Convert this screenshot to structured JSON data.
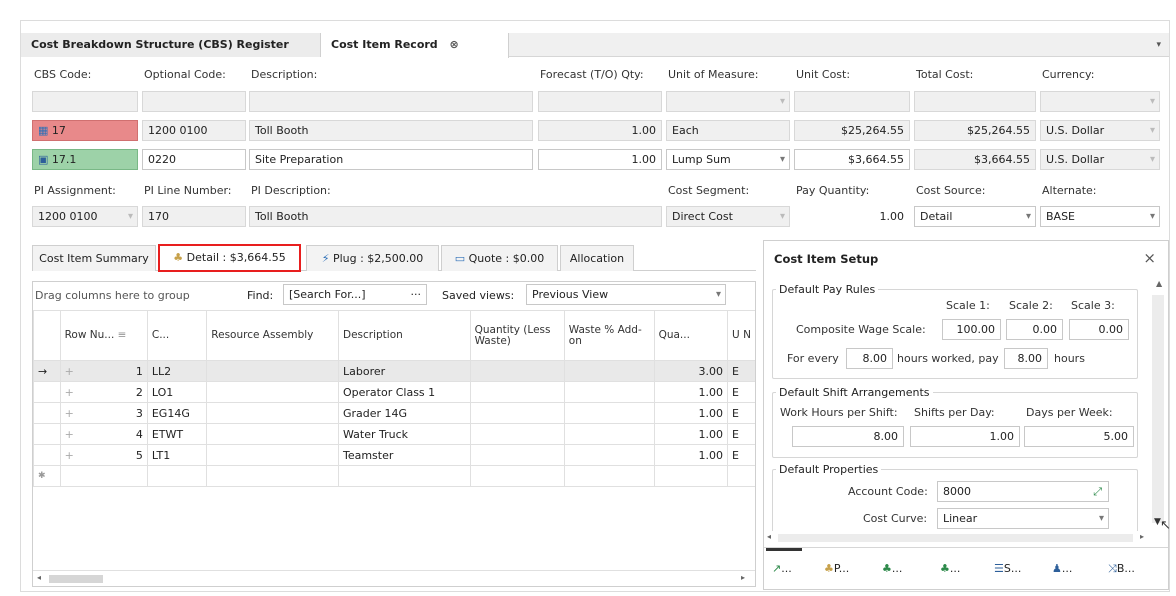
{
  "tabs": {
    "cbs_register": "Cost Breakdown Structure (CBS) Register",
    "cost_item_record": "Cost Item Record"
  },
  "header": {
    "labels": {
      "cbs_code": "CBS Code:",
      "optional_code": "Optional Code:",
      "description": "Description:",
      "forecast": "Forecast (T/O) Qty:",
      "uom": "Unit of Measure:",
      "unit_cost": "Unit Cost:",
      "total_cost": "Total Cost:",
      "currency": "Currency:"
    },
    "row1": {
      "cbs_code": "17",
      "optional_code": "1200 0100",
      "description": "Toll Booth",
      "forecast": "1.00",
      "uom": "Each",
      "unit_cost": "$25,264.55",
      "total_cost": "$25,264.55",
      "currency": "U.S. Dollar"
    },
    "row2": {
      "cbs_code": "17.1",
      "optional_code": "0220",
      "description": "Site Preparation",
      "forecast": "1.00",
      "uom": "Lump Sum",
      "unit_cost": "$3,664.55",
      "total_cost": "$3,664.55",
      "currency": "U.S. Dollar"
    },
    "labels2": {
      "pi_assignment": "PI Assignment:",
      "pi_line": "PI Line Number:",
      "pi_desc": "PI Description:",
      "cost_segment": "Cost Segment:",
      "pay_qty": "Pay Quantity:",
      "cost_source": "Cost Source:",
      "alternate": "Alternate:"
    },
    "row3": {
      "pi_assignment": "1200 0100",
      "pi_line": "170",
      "pi_desc": "Toll Booth",
      "cost_segment": "Direct Cost",
      "pay_qty": "1.00",
      "cost_source": "Detail",
      "alternate": "BASE"
    },
    "colors": {
      "row1_code": "#e8898a",
      "row2_code": "#9dd2a8",
      "highlight": "#e81e1e"
    }
  },
  "subtabs": {
    "summary": "Cost Item Summary",
    "detail": "Detail : $3,664.55",
    "plug": "Plug : $2,500.00",
    "quote": "Quote : $0.00",
    "allocation": "Allocation"
  },
  "grid": {
    "group_hint": "Drag columns here to group",
    "find_label": "Find:",
    "find_placeholder": "[Search For...]",
    "find_btn": "···",
    "saved_views_label": "Saved views:",
    "saved_view": "Previous View",
    "columns": [
      "Row Nu...",
      "C...",
      "Resource Assembly",
      "Description",
      "Quantity (Less Waste)",
      "Waste % Add-on",
      "Qua...",
      "U N"
    ],
    "rows": [
      {
        "num": "1",
        "code": "LL2",
        "desc": "Laborer",
        "qty": "3.00",
        "u": "E"
      },
      {
        "num": "2",
        "code": "LO1",
        "desc": "Operator Class 1",
        "qty": "1.00",
        "u": "E"
      },
      {
        "num": "3",
        "code": "EG14G",
        "desc": "Grader 14G",
        "qty": "1.00",
        "u": "E"
      },
      {
        "num": "4",
        "code": "ETWT",
        "desc": "Water Truck",
        "qty": "1.00",
        "u": "E"
      },
      {
        "num": "5",
        "code": "LT1",
        "desc": "Teamster",
        "qty": "1.00",
        "u": "E"
      }
    ]
  },
  "setup": {
    "title": "Cost Item Setup",
    "pay_rules": {
      "title": "Default Pay Rules",
      "scale1": "Scale 1:",
      "scale2": "Scale 2:",
      "scale3": "Scale 3:",
      "composite": "Composite Wage Scale:",
      "v1": "100.00",
      "v2": "0.00",
      "v3": "0.00",
      "for_every": "For every",
      "hours_val": "8.00",
      "hours_worked": "hours worked, pay",
      "pay_val": "8.00",
      "hours": "hours"
    },
    "shift": {
      "title": "Default Shift Arrangements",
      "work_hours": "Work Hours per Shift:",
      "shifts_day": "Shifts per Day:",
      "days_week": "Days per Week:",
      "v1": "8.00",
      "v2": "1.00",
      "v3": "5.00"
    },
    "props": {
      "title": "Default Properties",
      "account_code_label": "Account Code:",
      "account_code": "8000",
      "cost_curve_label": "Cost Curve:",
      "cost_curve": "Linear"
    },
    "bottom_tabs": [
      "...",
      "P...",
      "...",
      "...",
      "S...",
      "...",
      "B..."
    ]
  }
}
